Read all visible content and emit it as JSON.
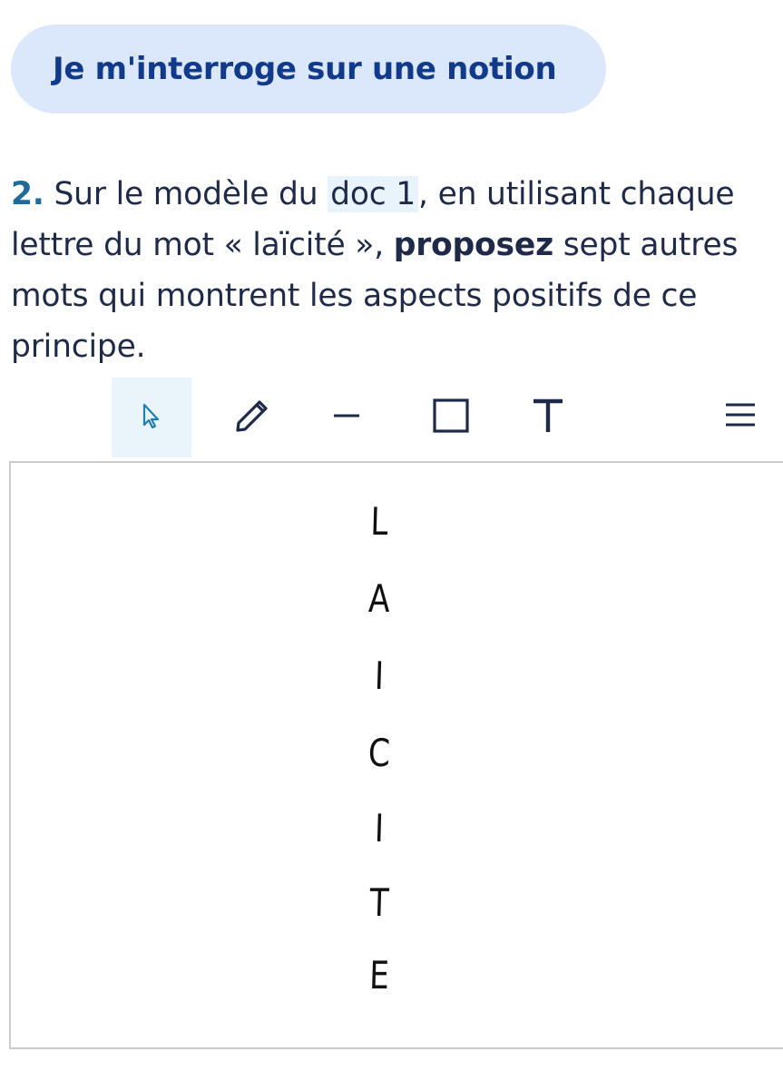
{
  "section": {
    "title": "Je m'interroge sur une notion"
  },
  "question": {
    "number": "2.",
    "text_before_ref": " Sur le modèle du ",
    "ref": "doc 1",
    "text_after_ref": ", en utilisant chaque lettre du mot « laïcité », ",
    "bold": "proposez",
    "text_end": " sept autres mots qui montrent les aspects positifs de ce principe."
  },
  "toolbar": {
    "tools": [
      {
        "name": "select",
        "icon": "pointer-icon",
        "active": true
      },
      {
        "name": "pen",
        "icon": "pencil-icon",
        "active": false
      },
      {
        "name": "line",
        "icon": "line-icon",
        "active": false
      },
      {
        "name": "rectangle",
        "icon": "rectangle-icon",
        "active": false
      },
      {
        "name": "text",
        "icon": "text-icon",
        "active": false
      },
      {
        "name": "menu",
        "icon": "menu-icon",
        "active": false
      }
    ]
  },
  "canvas": {
    "letters": [
      "L",
      "A",
      "I",
      "C",
      "I",
      "T",
      "E"
    ]
  },
  "colors": {
    "pill_bg": "#dbe7fb",
    "pill_text": "#123a8a",
    "number": "#1d6a9b",
    "active_tool_bg": "#e9f4fb",
    "text": "#1e2a48"
  }
}
